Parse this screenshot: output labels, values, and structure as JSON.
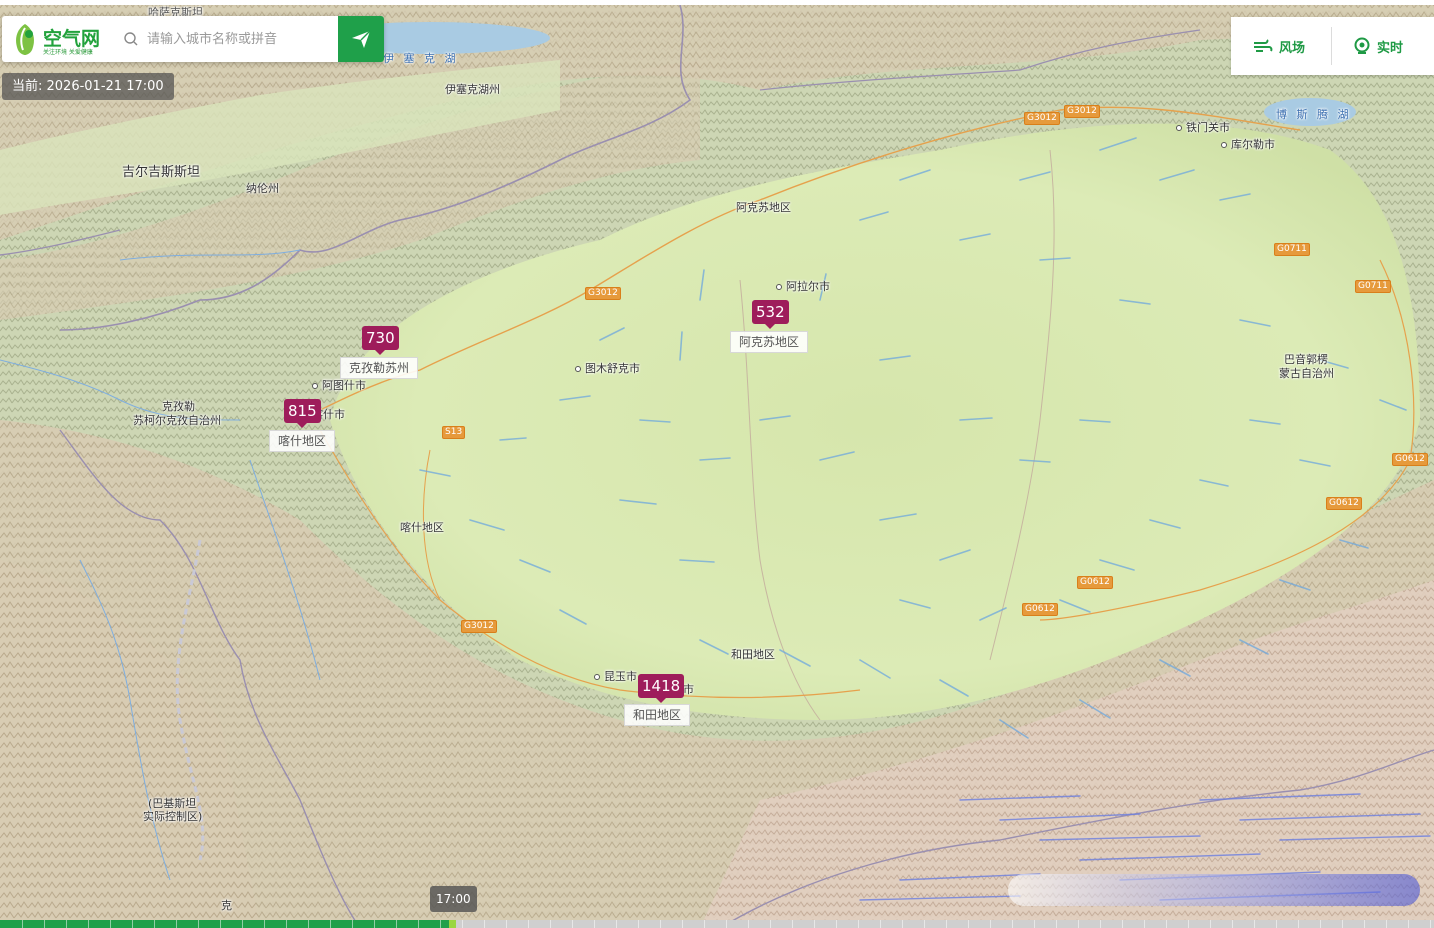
{
  "search": {
    "logo_text": "空气网",
    "logo_sub": "关注环境 关爱健康",
    "placeholder": "请输入城市名称或拼音"
  },
  "current_time": "当前: 2026-01-21 17:00",
  "controls": {
    "wind_label": "风场",
    "realtime_label": "实时"
  },
  "markers": [
    {
      "value": "730",
      "region": "克孜勒苏州"
    },
    {
      "value": "815",
      "region": "喀什地区"
    },
    {
      "value": "532",
      "region": "阿克苏地区"
    },
    {
      "value": "1418",
      "region": "和田地区"
    }
  ],
  "map_labels": {
    "kazakh_top": "哈萨克斯坦",
    "lake1": "伊 塞 克 湖",
    "lake2": "伊塞克湖州",
    "kyrgyzstan": "吉尔吉斯斯坦",
    "naryn": "纳伦州",
    "aksu_region": "阿克苏地区",
    "alaer": "阿拉尔市",
    "tumshuq": "图木舒克市",
    "artux": "阿图什市",
    "kashgar_city": "喀什市",
    "kizilsu1": "克孜勒",
    "kizilsu2": "苏柯尔克孜自治州",
    "kashgar_region": "喀什地区",
    "hotan_region": "和田地区",
    "kunyu": "昆玉市",
    "hotan_city": "和田市",
    "tiemenguan": "铁门关市",
    "korla": "库尔勒市",
    "bosten": "博 斯 腾 湖",
    "bayingol1": "巴音郭楞",
    "bayingol2": "蒙古自治州",
    "pak1": "(巴基斯坦",
    "pak2": "实际控制区)",
    "bottom_k": "克"
  },
  "roads": {
    "g3012_a": "G3012",
    "g3012_b": "G3012",
    "g3012_c": "G3012",
    "g3012_d": "G3012",
    "s13": "S13",
    "g0711_a": "G0711",
    "g0711_b": "G0711",
    "g0612_a": "G0612",
    "g0612_b": "G0612",
    "g0612_c": "G0612",
    "g0612_d": "G0612"
  },
  "timeline": {
    "time_label": "17:00",
    "progress": 0.313
  },
  "colors": {
    "brand_green": "#1fa04a",
    "aqi_marker": "#9e1d5b",
    "basin": "#dbe9b4",
    "mountain": "#d9ccb4"
  },
  "icons": {
    "search": "search-icon",
    "send": "send-icon",
    "wind": "wind-icon",
    "realtime": "realtime-icon",
    "logo": "logo-icon"
  }
}
